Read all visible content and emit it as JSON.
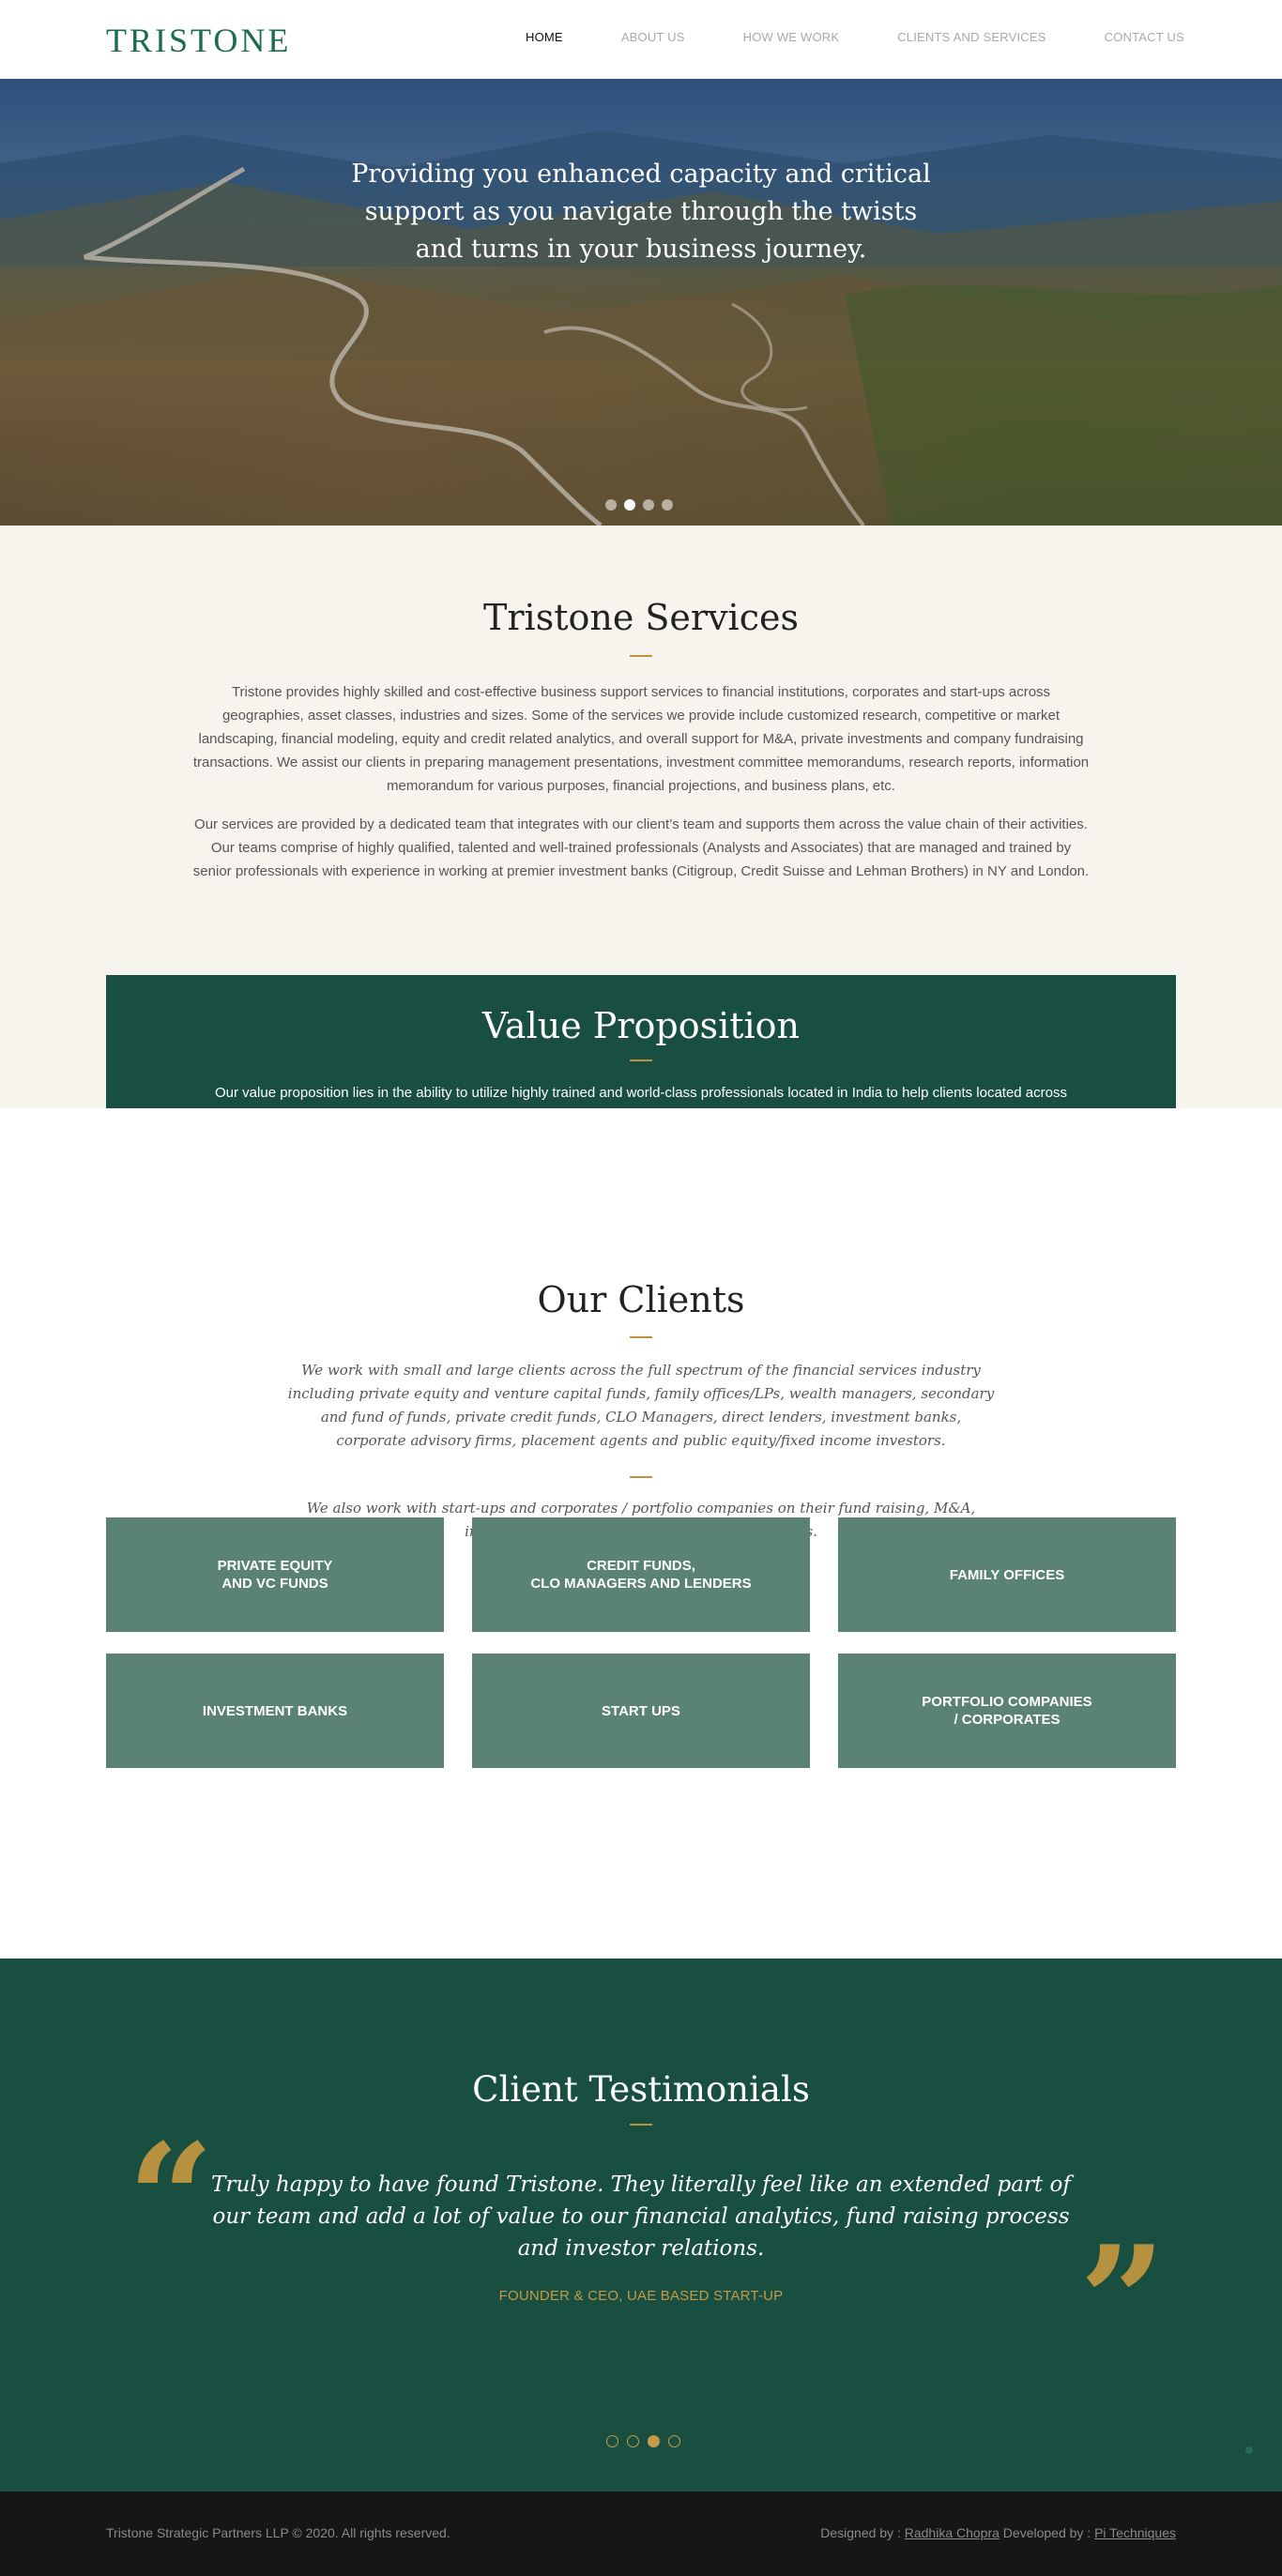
{
  "header": {
    "logo": "TRISTONE",
    "nav": [
      "HOME",
      "ABOUT US",
      "HOW WE WORK",
      "CLIENTS AND SERVICES",
      "CONTACT US"
    ],
    "active_nav": "HOME"
  },
  "hero": {
    "lines": [
      "Providing you enhanced capacity and critical",
      "support as you navigate through the twists",
      "and turns in your business journey."
    ],
    "slides": 4,
    "active_slide": 2
  },
  "services": {
    "title": "Tristone Services",
    "p1": "Tristone provides highly skilled and cost-effective business support services to financial institutions, corporates and start-ups across geographies, asset classes, industries and sizes. Some of the services we provide include customized research, competitive or market landscaping, financial modeling, equity and credit related analytics, and overall support for M&A, private investments and company fundraising transactions. We assist our clients in preparing management presentations, investment committee memorandums, research reports, information memorandum for various purposes, financial projections, and business plans, etc.",
    "p2": "Our services are provided by a dedicated team that integrates with our client’s team and supports them across the value chain of their activities. Our teams comprise of highly qualified, talented and well-trained professionals (Analysts and Associates) that are managed and trained by senior professionals with experience in working at premier investment banks (Citigroup, Credit Suisse and Lehman Brothers) in NY and London."
  },
  "value": {
    "title": "Value Proposition",
    "text": "Our value proposition lies in the ability to utilize highly trained and world-class professionals located in India to help clients located across different geographies to scale up their business or staff a time-consuming transaction while at the same time retaining full control and without incurring additional fixed costs. Ultimately our service results in significant cost savings and increased efficiency for a client."
  },
  "clients": {
    "title": "Our Clients",
    "p1": "We work with small and large clients across the full spectrum of the financial services industry including private equity and venture capital funds, family offices/LPs, wealth managers, secondary and fund of funds, private credit funds, CLO Managers, direct lenders, investment banks, corporate advisory firms, placement agents and public equity/fixed income investors.",
    "p2": "We also work with start-ups and corporates / portfolio companies on their fund raising, M&A, investor relations and other CFO office activities.",
    "tiles": [
      [
        "PRIVATE EQUITY",
        "AND VC FUNDS"
      ],
      [
        "CREDIT FUNDS,",
        "CLO MANAGERS AND LENDERS"
      ],
      [
        "FAMILY OFFICES"
      ],
      [
        "INVESTMENT BANKS"
      ],
      [
        "START UPS"
      ],
      [
        "PORTFOLIO COMPANIES",
        "/ CORPORATES"
      ]
    ]
  },
  "testimonials": {
    "title": "Client Testimonials",
    "quote": "Truly happy to have found Tristone. They literally feel like an extended part of our team and add a lot of value to our financial analytics, fund raising process and investor relations.",
    "author": "FOUNDER & CEO, UAE BASED START-UP",
    "open_mark": "“",
    "close_mark": "”",
    "slides": 4,
    "active_slide": 3
  },
  "footer": {
    "copyright": "Tristone Strategic Partners LLP © 2020. All rights reserved.",
    "designed_prefix": "Designed by : ",
    "designer": "Radhika Chopra",
    "developed_prefix": " Developed by : ",
    "developer": "Pi Techniques"
  },
  "colors": {
    "brand_green": "#184f41",
    "tile_green": "#5a8275",
    "accent_gold": "#c0913b",
    "cream": "#f6f4ed"
  }
}
